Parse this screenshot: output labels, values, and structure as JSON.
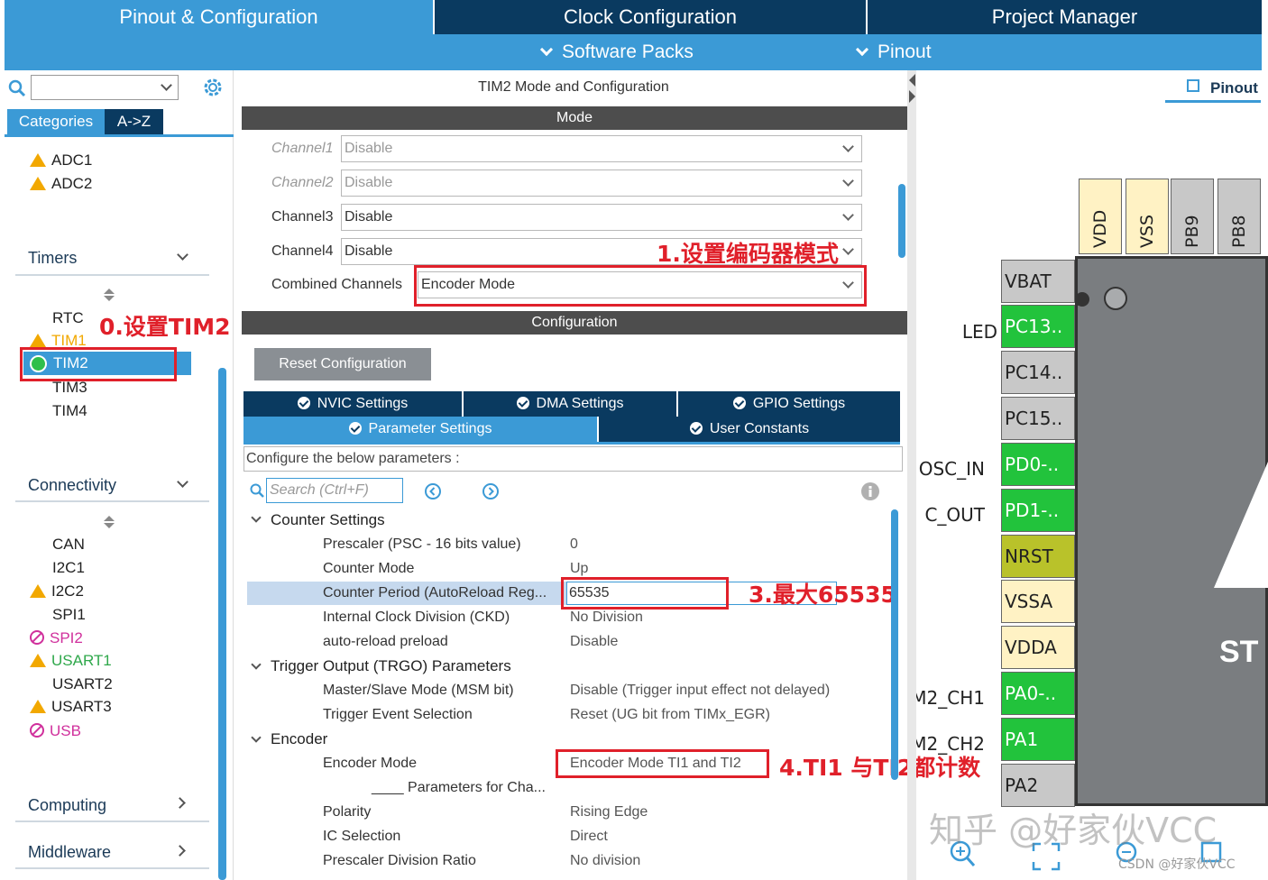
{
  "tabs": {
    "pinout_config": "Pinout & Configuration",
    "clock_config": "Clock Configuration",
    "project_manager": "Project Manager"
  },
  "subbar": {
    "software_packs": "Software Packs",
    "pinout": "Pinout"
  },
  "left": {
    "tab_categories": "Categories",
    "tab_az": "A->Z",
    "analog_items": [
      "ADC1",
      "ADC2"
    ],
    "timers_section": "Timers",
    "timer_items": [
      "RTC",
      "TIM1",
      "TIM2",
      "TIM3",
      "TIM4"
    ],
    "connectivity_section": "Connectivity",
    "connectivity_items": [
      "CAN",
      "I2C1",
      "I2C2",
      "SPI1",
      "SPI2",
      "USART1",
      "USART2",
      "USART3",
      "USB"
    ],
    "computing_section": "Computing",
    "middleware_section": "Middleware"
  },
  "mid": {
    "title": "TIM2 Mode and Configuration",
    "mode_bar": "Mode",
    "channels": [
      {
        "label": "Channel1",
        "value": "Disable"
      },
      {
        "label": "Channel2",
        "value": "Disable"
      },
      {
        "label": "Channel3",
        "value": "Disable"
      },
      {
        "label": "Channel4",
        "value": "Disable"
      }
    ],
    "combined_label": "Combined Channels",
    "combined_value": "Encoder Mode",
    "config_bar": "Configuration",
    "reset_button": "Reset Configuration",
    "tabs_row1": [
      "NVIC Settings",
      "DMA Settings",
      "GPIO Settings"
    ],
    "tabs_row2": [
      "Parameter Settings",
      "User Constants"
    ],
    "configure_text": "Configure the below parameters :",
    "search_placeholder": "Search (Ctrl+F)",
    "counter_group": "Counter Settings",
    "counter_params": [
      {
        "label": "Prescaler (PSC - 16 bits value)",
        "value": "0"
      },
      {
        "label": "Counter Mode",
        "value": "Up"
      },
      {
        "label": "Counter Period (AutoReload Reg...",
        "value": "65535"
      },
      {
        "label": "Internal Clock Division (CKD)",
        "value": "No Division"
      },
      {
        "label": "auto-reload preload",
        "value": "Disable"
      }
    ],
    "trgo_group": "Trigger Output (TRGO) Parameters",
    "trgo_params": [
      {
        "label": "Master/Slave Mode (MSM bit)",
        "value": "Disable (Trigger input effect not delayed)"
      },
      {
        "label": "Trigger Event Selection",
        "value": "Reset (UG bit from TIMx_EGR)"
      }
    ],
    "encoder_group": "Encoder",
    "encoder_mode_label": "Encoder Mode",
    "encoder_mode_value": "Encoder Mode TI1 and TI2",
    "params_for_channel": "____ Parameters for Cha...",
    "encoder_params": [
      {
        "label": "Polarity",
        "value": "Rising Edge"
      },
      {
        "label": "IC Selection",
        "value": "Direct"
      },
      {
        "label": "Prescaler Division Ratio",
        "value": "No division"
      }
    ]
  },
  "annotations": {
    "step0": "0.设置TIM2",
    "step1": "1.设置编码器模式",
    "step3": "3.最大65535",
    "step4": "4.TI1 与TI2都计数"
  },
  "right": {
    "pinout_tab": "Pinout",
    "top_pins": [
      "VDD",
      "VSS",
      "PB9",
      "PB8"
    ],
    "side_pins": [
      {
        "name": "VBAT",
        "color": "grey",
        "label": ""
      },
      {
        "name": "PC13..",
        "color": "green",
        "label": "LED"
      },
      {
        "name": "PC14..",
        "color": "grey",
        "label": ""
      },
      {
        "name": "PC15..",
        "color": "grey",
        "label": ""
      },
      {
        "name": "PD0-..",
        "color": "green",
        "label": "OSC_IN"
      },
      {
        "name": "PD1-..",
        "color": "green",
        "label": "C_OUT"
      },
      {
        "name": "NRST",
        "color": "olive",
        "label": ""
      },
      {
        "name": "VSSA",
        "color": "yellow",
        "label": ""
      },
      {
        "name": "VDDA",
        "color": "yellow",
        "label": ""
      },
      {
        "name": "PA0-..",
        "color": "green",
        "label": "M2_CH1"
      },
      {
        "name": "PA1",
        "color": "green",
        "label": "M2_CH2"
      },
      {
        "name": "PA2",
        "color": "grey",
        "label": ""
      }
    ],
    "chip_text": "ST",
    "watermark": "知乎 @好家伙VCC",
    "csdn_credit": "CSDN @好家伙VCC"
  }
}
